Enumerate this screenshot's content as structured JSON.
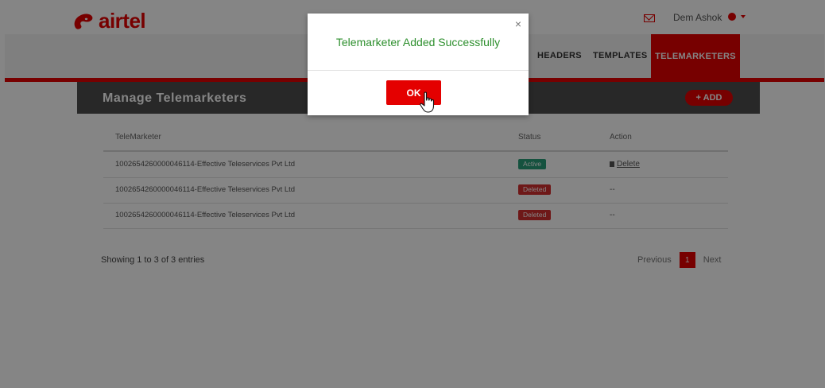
{
  "header": {
    "logo_text": "airtel",
    "user_name": "Dem Ashok"
  },
  "nav": {
    "items": [
      "HEADERS",
      "TEMPLATES"
    ],
    "active": "TELEMARKETERS"
  },
  "panel": {
    "title": "Manage Telemarketers",
    "add_label": "+ ADD"
  },
  "table": {
    "columns": [
      "TeleMarketer",
      "Status",
      "Action"
    ],
    "rows": [
      {
        "telemarketer": "1002654260000046114-Effective Teleservices Pvt Ltd",
        "status": "Active",
        "action": "Delete"
      },
      {
        "telemarketer": "1002654260000046114-Effective Teleservices Pvt Ltd",
        "status": "Deleted",
        "action": "--"
      },
      {
        "telemarketer": "1002654260000046114-Effective Teleservices Pvt Ltd",
        "status": "Deleted",
        "action": "--"
      }
    ]
  },
  "pagination": {
    "info": "Showing 1 to 3 of 3 entries",
    "previous": "Previous",
    "page": "1",
    "next": "Next"
  },
  "modal": {
    "close": "×",
    "message": "Telemarketer Added Successfully",
    "ok_label": "OK"
  },
  "colors": {
    "brand": "#e40000",
    "active_badge": "#2a9d79",
    "deleted_badge": "#d32f2f",
    "success_text": "#2d8f2d"
  }
}
